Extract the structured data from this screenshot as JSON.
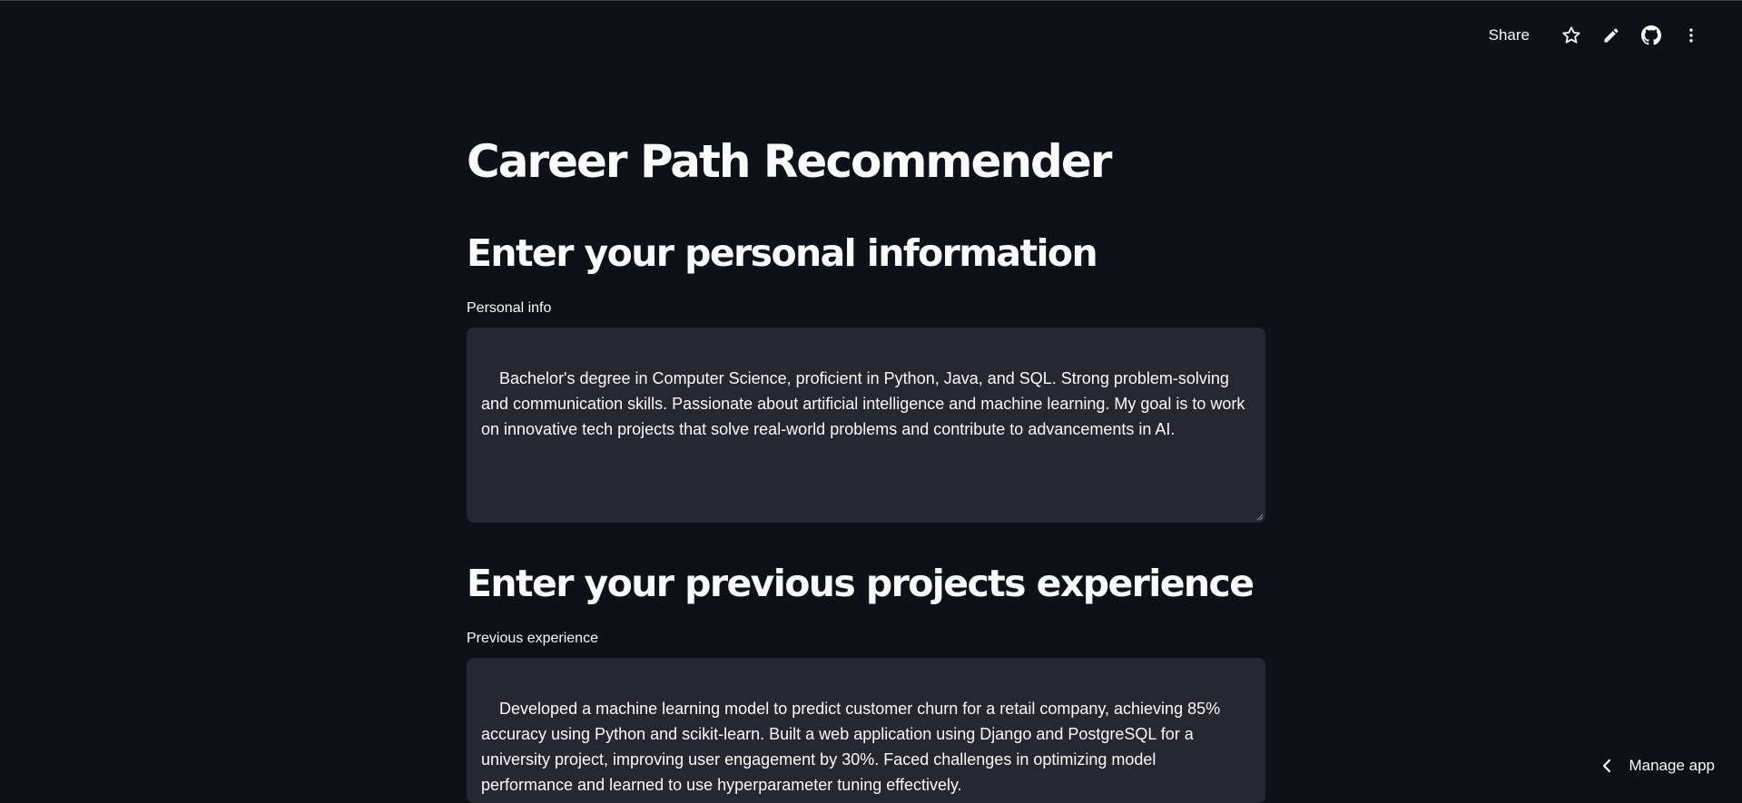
{
  "toolbar": {
    "share_label": "Share",
    "icons": [
      "star-icon",
      "pencil-icon",
      "github-icon",
      "more-vertical-icon"
    ]
  },
  "main": {
    "title": "Career Path Recommender",
    "section1": {
      "heading": "Enter your personal information",
      "field_label": "Personal info",
      "value": "Bachelor's degree in Computer Science, proficient in Python, Java, and SQL. Strong problem-solving and communication skills. Passionate about artificial intelligence and machine learning. My goal is to work on innovative tech projects that solve real-world problems and contribute to advancements in AI."
    },
    "section2": {
      "heading": "Enter your previous projects experience",
      "field_label": "Previous experience",
      "value": "Developed a machine learning model to predict customer churn for a retail company, achieving 85% accuracy using Python and scikit-learn. Built a web application using Django and PostgreSQL for a university project, improving user engagement by 30%. Faced challenges in optimizing model performance and learned to use hyperparameter tuning effectively."
    }
  },
  "footer": {
    "manage_label": "Manage app"
  },
  "colors": {
    "background": "#0e1117",
    "input_bg": "#262730",
    "text": "#fafafa"
  }
}
